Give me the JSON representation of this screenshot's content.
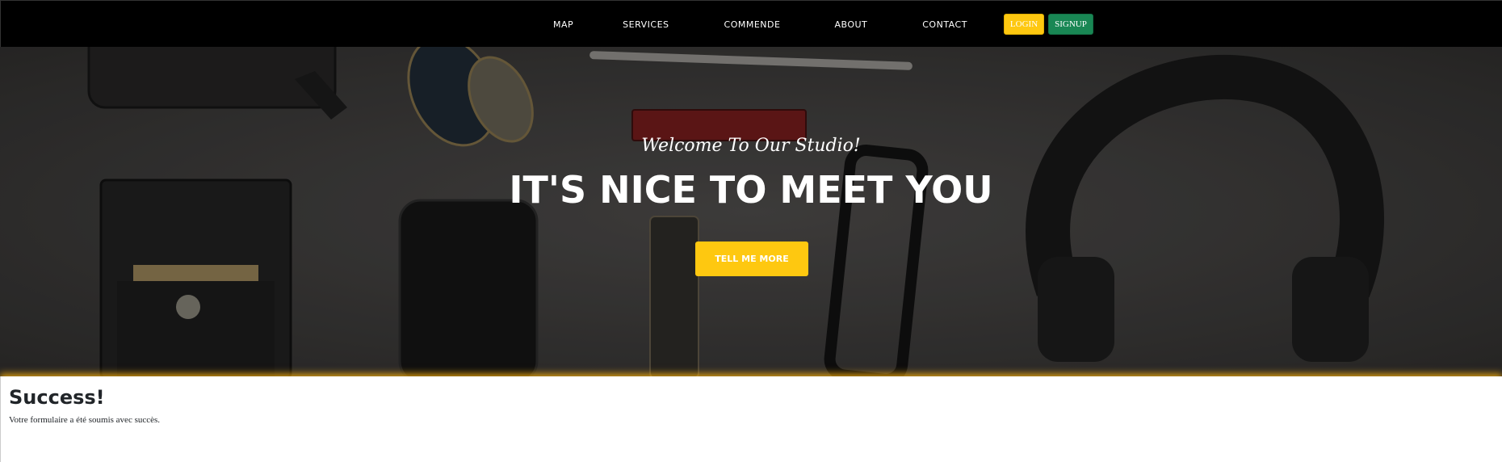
{
  "nav": {
    "links": [
      "MAP",
      "SERVICES",
      "COMMENDE",
      "ABOUT",
      "CONTACT"
    ],
    "login_label": "LOGIN",
    "signup_label": "SIGNUP"
  },
  "hero": {
    "subtitle": "Welcome To Our Studio!",
    "title": "IT'S NICE TO MEET YOU",
    "button_label": "TELL ME MORE"
  },
  "alert": {
    "title": "Success!",
    "message": "Votre formulaire a été soumis avec succès."
  },
  "colors": {
    "navbar_bg": "#000000",
    "accent_yellow": "#fec810",
    "signup_green": "#198754",
    "hero_bg": "#3b3a39"
  }
}
